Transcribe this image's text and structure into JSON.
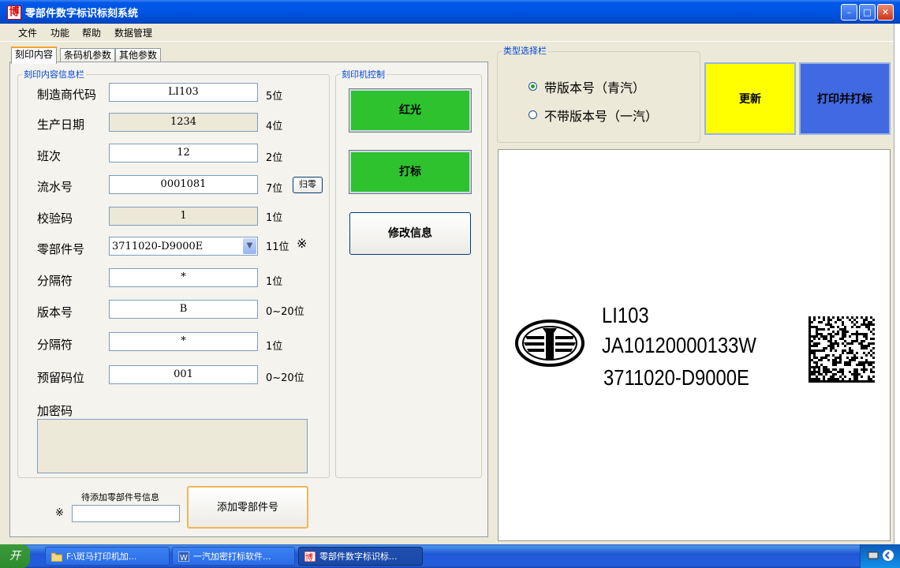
{
  "window": {
    "title": "零部件数字标识标刻系统",
    "app_icon_char": "博",
    "controls": {
      "minimize": "–",
      "maximize": "□",
      "close": "✕"
    }
  },
  "menu": [
    "文件",
    "功能",
    "帮助",
    "数据管理"
  ],
  "tabs": [
    "刻印内容",
    "条码机参数",
    "其他参数"
  ],
  "content_group": {
    "title": "刻印内容信息栏",
    "fields": [
      {
        "label": "制造商代码",
        "value": "LI103",
        "unit": "5位",
        "readonly": false
      },
      {
        "label": "生产日期",
        "value": "1234",
        "unit": "4位",
        "readonly": true
      },
      {
        "label": "班次",
        "value": "12",
        "unit": "2位",
        "readonly": false
      },
      {
        "label": "流水号",
        "value": "0001081",
        "unit": "7位",
        "readonly": false
      },
      {
        "label": "校验码",
        "value": "1",
        "unit": "1位",
        "readonly": true
      },
      {
        "label": "零部件号",
        "value": "3711020-D9000E",
        "unit": "11位",
        "readonly": false
      },
      {
        "label": "分隔符",
        "value": "*",
        "unit": "1位",
        "readonly": false
      },
      {
        "label": "版本号",
        "value": "B",
        "unit": "0~20位",
        "readonly": false
      },
      {
        "label": "分隔符",
        "value": "*",
        "unit": "1位",
        "readonly": false
      },
      {
        "label": "预留码位",
        "value": "001",
        "unit": "0~20位",
        "readonly": false
      }
    ],
    "reset_button": "归零",
    "part_mark": "※",
    "encrypt_label": "加密码",
    "encrypt_value": ""
  },
  "add_part": {
    "label": "待添加零部件号信息",
    "mark": "※",
    "input_value": "",
    "button": "添加零部件号"
  },
  "printer_group": {
    "title": "刻印机控制",
    "buttons": [
      "红光",
      "打标",
      "修改信息"
    ]
  },
  "type_group": {
    "title": "类型选择栏",
    "options": [
      {
        "label": "带版本号（青汽）",
        "checked": true
      },
      {
        "label": "不带版本号（一汽）",
        "checked": false
      }
    ]
  },
  "actions": {
    "update": "更新",
    "print_mark": "打印并打标",
    "update_color": "#FFFF00",
    "print_color": "#4169E1"
  },
  "preview": {
    "line1": "LI103",
    "line2": "JA10120000133W",
    "line3": "3711020-D9000E"
  },
  "taskbar": {
    "start_label": "开",
    "tasks": [
      {
        "label": "F:\\斑马打印机加...",
        "icon": "folder-icon",
        "active": false
      },
      {
        "label": "一汽加密打标软件...",
        "icon": "word-icon",
        "active": false
      },
      {
        "label": "零部件数字标识标...",
        "icon": "app-icon",
        "active": true
      }
    ]
  }
}
